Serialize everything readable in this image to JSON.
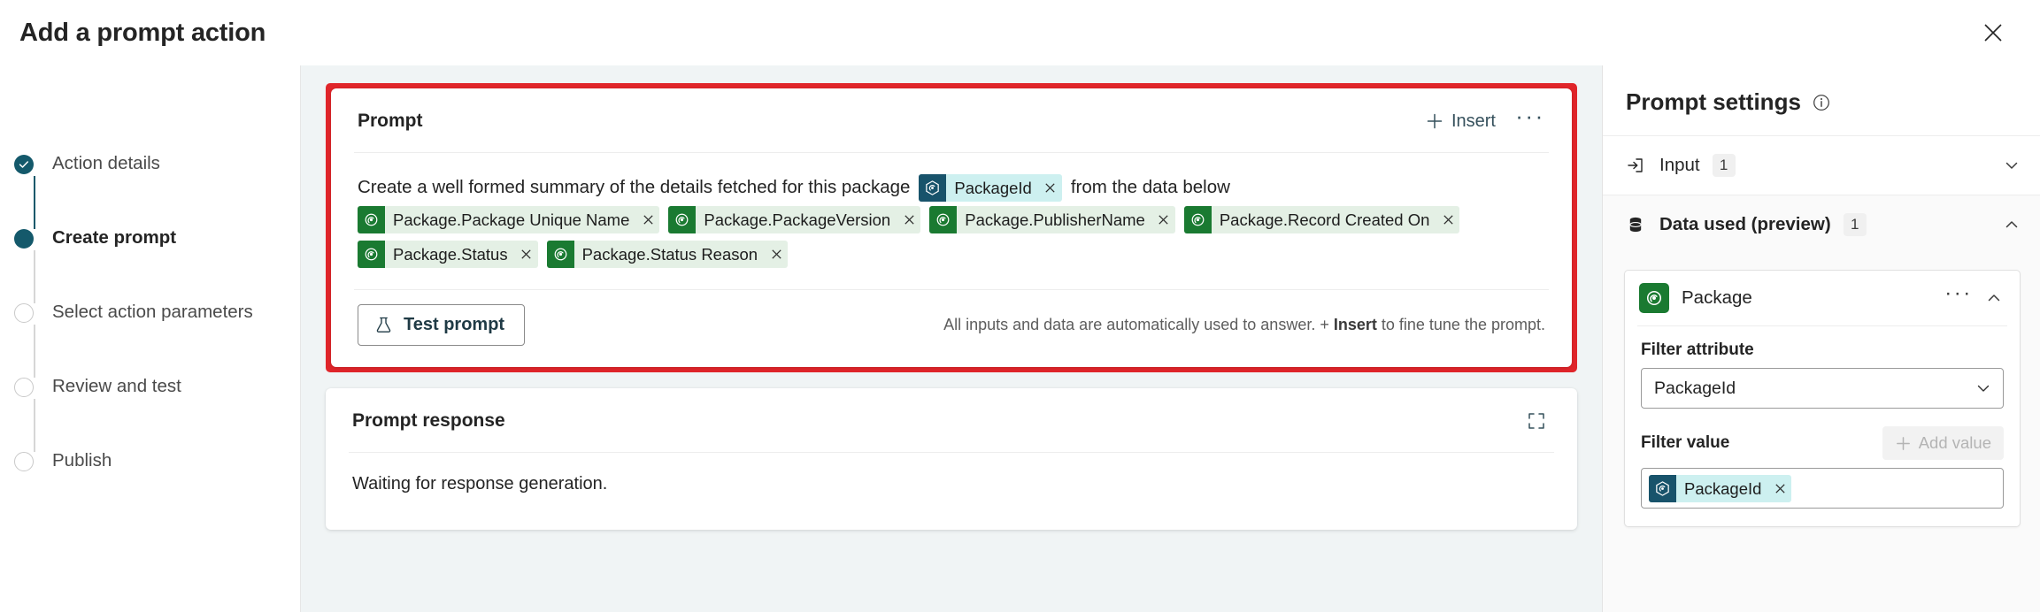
{
  "header": {
    "title": "Add a prompt action",
    "close_icon": "close-icon"
  },
  "wizard": {
    "steps": [
      {
        "label": "Action details",
        "state": "done"
      },
      {
        "label": "Create prompt",
        "state": "current"
      },
      {
        "label": "Select action parameters",
        "state": "todo"
      },
      {
        "label": "Review and test",
        "state": "todo"
      },
      {
        "label": "Publish",
        "state": "todo"
      }
    ]
  },
  "prompt_card": {
    "title": "Prompt",
    "insert_label": "Insert",
    "insert_icon": "plus-icon",
    "more_label": "···",
    "text_before": "Create a well formed summary of the details fetched for this package",
    "text_after": "from the data below",
    "inline_token": {
      "label": "PackageId",
      "type": "blue",
      "icon": "package-entity-icon",
      "remove_icon": "close-icon"
    },
    "token_rows": [
      [
        {
          "label": "Package.Package Unique Name",
          "type": "green",
          "icon": "table-icon",
          "remove_icon": "close-icon"
        },
        {
          "label": "Package.PackageVersion",
          "type": "green",
          "icon": "table-icon",
          "remove_icon": "close-icon"
        },
        {
          "label": "Package.PublisherName",
          "type": "green",
          "icon": "table-icon",
          "remove_icon": "close-icon"
        },
        {
          "label": "Package.Record Created On",
          "type": "green",
          "icon": "table-icon",
          "remove_icon": "close-icon"
        }
      ],
      [
        {
          "label": "Package.Status",
          "type": "green",
          "icon": "table-icon",
          "remove_icon": "close-icon"
        },
        {
          "label": "Package.Status Reason",
          "type": "green",
          "icon": "table-icon",
          "remove_icon": "close-icon"
        }
      ]
    ],
    "test_button": {
      "label": "Test prompt",
      "icon": "beaker-icon"
    },
    "hint_plain_1": "All inputs and data are automatically used to answer. + ",
    "hint_bold": "Insert",
    "hint_plain_2": " to fine tune the prompt.",
    "highlight_color": "#e0252a"
  },
  "response_card": {
    "title": "Prompt response",
    "expand_icon": "expand-icon",
    "body_text": "Waiting for response generation."
  },
  "settings": {
    "title": "Prompt settings",
    "info_icon": "info-icon",
    "sections": [
      {
        "label": "Input",
        "badge": "1",
        "icon": "input-arrow-icon",
        "chevron": "chevron-down-icon",
        "expanded": false
      },
      {
        "label": "Data used (preview)",
        "badge": "1",
        "icon": "database-icon",
        "chevron": "chevron-up-icon",
        "expanded": true
      }
    ],
    "entity": {
      "name": "Package",
      "icon": "table-icon",
      "more_label": "···",
      "chevron": "chevron-up-icon",
      "filter_attribute_label": "Filter attribute",
      "filter_attribute_value": "PackageId",
      "filter_attribute_chevron": "chevron-down-icon",
      "filter_value_label": "Filter value",
      "add_value_label": "Add value",
      "add_value_icon": "plus-icon",
      "filter_value_token": {
        "label": "PackageId",
        "type": "blue",
        "icon": "package-entity-icon",
        "remove_icon": "close-icon"
      }
    }
  },
  "colors": {
    "accent_teal": "#14596b",
    "token_green_bg": "#e4f0e5",
    "token_green_icon": "#1a7a31",
    "token_blue_bg": "#cdf0f0",
    "token_blue_icon": "#18536b",
    "highlight_red": "#e0252a",
    "canvas_bg": "#f0f4f5"
  }
}
